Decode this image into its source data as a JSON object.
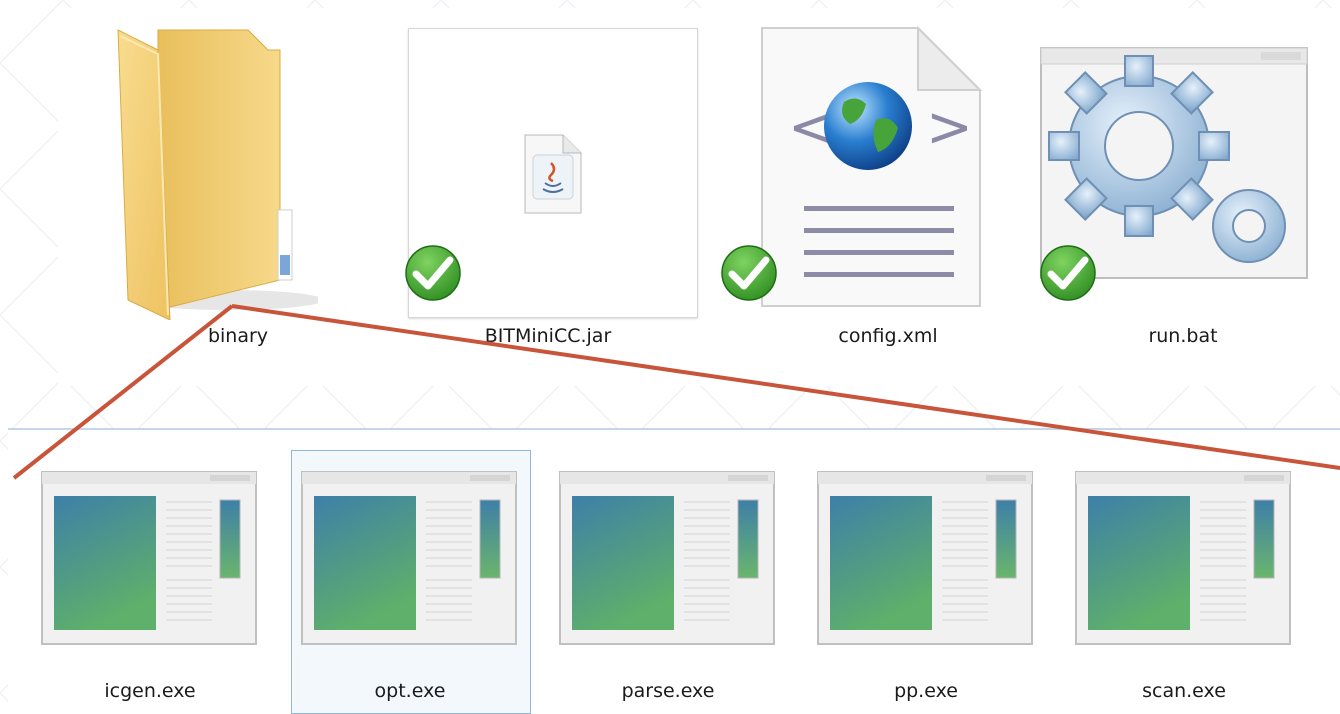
{
  "top_row": [
    {
      "name": "binary",
      "kind": "folder",
      "checked": false
    },
    {
      "name": "BITMiniCC.jar",
      "kind": "jar",
      "checked": true
    },
    {
      "name": "config.xml",
      "kind": "xml",
      "checked": true
    },
    {
      "name": "run.bat",
      "kind": "bat",
      "checked": true
    }
  ],
  "bottom_row": [
    {
      "name": "icgen.exe",
      "kind": "exe",
      "selected": false
    },
    {
      "name": "opt.exe",
      "kind": "exe",
      "selected": true
    },
    {
      "name": "parse.exe",
      "kind": "exe",
      "selected": false
    },
    {
      "name": "pp.exe",
      "kind": "exe",
      "selected": false
    },
    {
      "name": "scan.exe",
      "kind": "exe",
      "selected": false
    }
  ],
  "colors": {
    "annotation_line": "#c8553a",
    "check_green": "#3a9a2a",
    "folder": "#f3cc6a",
    "selection_border": "#8fb6de"
  }
}
